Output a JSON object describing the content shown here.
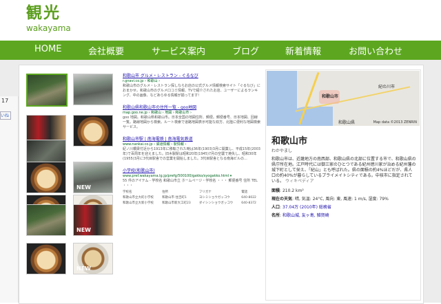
{
  "site": {
    "logo_kanji": "観光",
    "logo_roman": "wakayama"
  },
  "nav": {
    "items": [
      "HOME",
      "会社概要",
      "サービス案内",
      "ブログ",
      "新着情報",
      "お問い合わせ"
    ]
  },
  "left_strip": {
    "number": "17",
    "badge": "いね"
  },
  "thumbnails": {
    "new_label": "NEW"
  },
  "results": [
    {
      "title": "和歌山市 グルメ・レストラン - ぐるなび",
      "url": "r.gnavi.co.jp › 和歌山 ›",
      "snippet": "和歌山市のグルメ・レストラン探しならお店の公式グルメ情報検索サイト「ぐるなび」におまかせ。和歌山市のグルメ口コミ情報、TVで紹介されたお店、ユーザーによるランキング、中の画像、などあらゆる情報が揃ってます!"
    },
    {
      "title": "和歌山県和歌山市の住所一覧 - goo地図",
      "url": "map.goo.ne.jp › 和歌山 › 地図 › 和歌山市 ›",
      "snippet": "goo 地図。和歌山県和歌山市。日本全国の地図住所、郵便。郵便番号、日本地図、回線一覧。路線地図から検索。ルート検索で道路地図表示可能な双方、北陸に便利な地図検索サービス。"
    },
    {
      "title": "和歌山市駅 | 南海電鉄 | 南海電気鉄道",
      "url": "www.nankai.co.jp › 鉄道情報 › 駅情報 ›",
      "snippet": "紀ノ川橋梁付近から1913年に移転された時は36年(1903)3月に開業し、平成15年(2003年)で百周年を迎えました。旧木製駅は昭和20年(1945)7月の空襲で焼失し、昭和30年(1955)3月に3代目駅舎での営業を開始しました。3代目駅舎となる南海ビルの..."
    },
    {
      "title": "小学校(和歌山市)",
      "url": "www.pref.wakayama.lg.jp/prefg/500100/gakko/syogakko.html ▾",
      "snippet": "55 件のアイテム - 学校名 和歌山市立 ホームページ・学校名 ・・・ 郵便番号 住所 TEL ・・・"
    },
    {
      "table": [
        "学校名",
        "住所",
        "フリガナ",
        "電話",
        "和歌山市立大町小学校",
        "和歌山市 住吉町1",
        "ヨシミショウガッコウ",
        "640-8022",
        "和歌山市立大新小学校",
        "和歌山市新大工町23",
        "ダイシンショウガッコウ",
        "640-8372"
      ]
    }
  ],
  "knowledge": {
    "map_labels": [
      "紀の川市",
      "和歌山市",
      "和歌山県"
    ],
    "map_copyright": "Map data ©2013 ZENRIN",
    "name": "和歌山市",
    "reading": "わかやまし",
    "description": "和歌山市は、近畿地方の南西部、和歌山県の北部に位置する市で、和歌山県の県庁所在地。江戸時代には御三家のひとつである紀州徳川家が治める紀州藩の城下町として栄え、「紀山」とも呼ばれた。県の面積の約4%ほどだが、県人口の約40%が暮らしているプライメイトシティである。中核市に指定されている。",
    "source": "ウィキペディア",
    "area_label": "面積",
    "area_value": "210.2 km²",
    "weather_label": "現在の天気",
    "weather_value": "晴, 気温: 24°C, 風向: 東, 風速: 1 m/s, 湿度: 79%",
    "population_label": "人口",
    "population_value": "37.04万 (2010年)",
    "population_source": "総務省",
    "sights_label": "名所",
    "sights_value": "和歌山城, 友ヶ島, 雑賀崎"
  }
}
